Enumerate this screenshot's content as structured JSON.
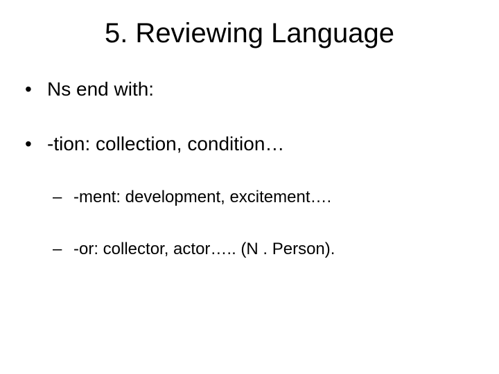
{
  "slide": {
    "title": "5. Reviewing Language",
    "bullets": {
      "b1": "Ns end with:",
      "b2": " -tion: collection, condition…",
      "sub1": "-ment: development, excitement….",
      "sub2": " -or: collector, actor….. (N . Person)."
    }
  }
}
